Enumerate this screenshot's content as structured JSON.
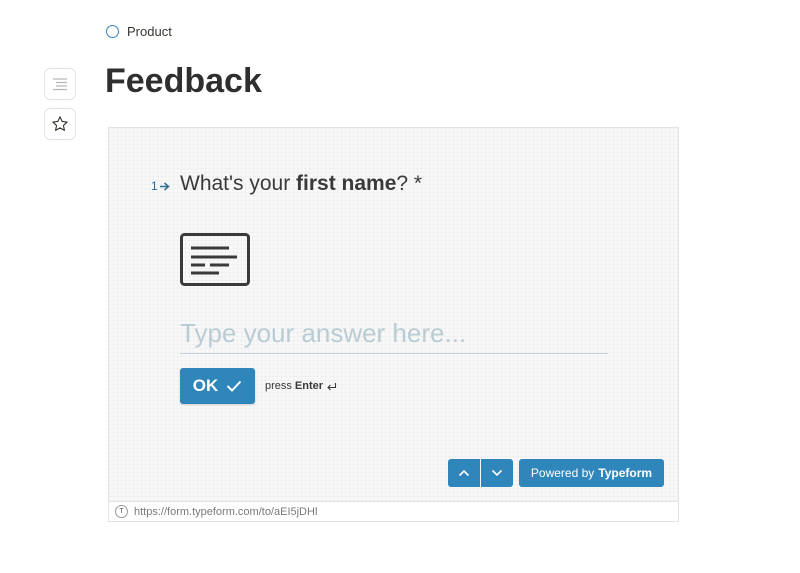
{
  "breadcrumb": {
    "label": "Product"
  },
  "page": {
    "title": "Feedback"
  },
  "sidebar": {
    "toc_icon": "table-of-contents-icon",
    "star_icon": "star-icon"
  },
  "form": {
    "question_number": "1",
    "question_prefix": "What's your ",
    "question_bold": "first name",
    "question_suffix": "? *",
    "answer_placeholder": "Type your answer here...",
    "answer_value": "",
    "ok_label": "OK",
    "press_label": "press",
    "enter_label": "Enter",
    "powered_prefix": "Powered by",
    "powered_brand": "Typeform",
    "accent_color": "#2f86bb"
  },
  "embed": {
    "url_icon_letter": "T",
    "url": "https://form.typeform.com/to/aEI5jDHl"
  }
}
